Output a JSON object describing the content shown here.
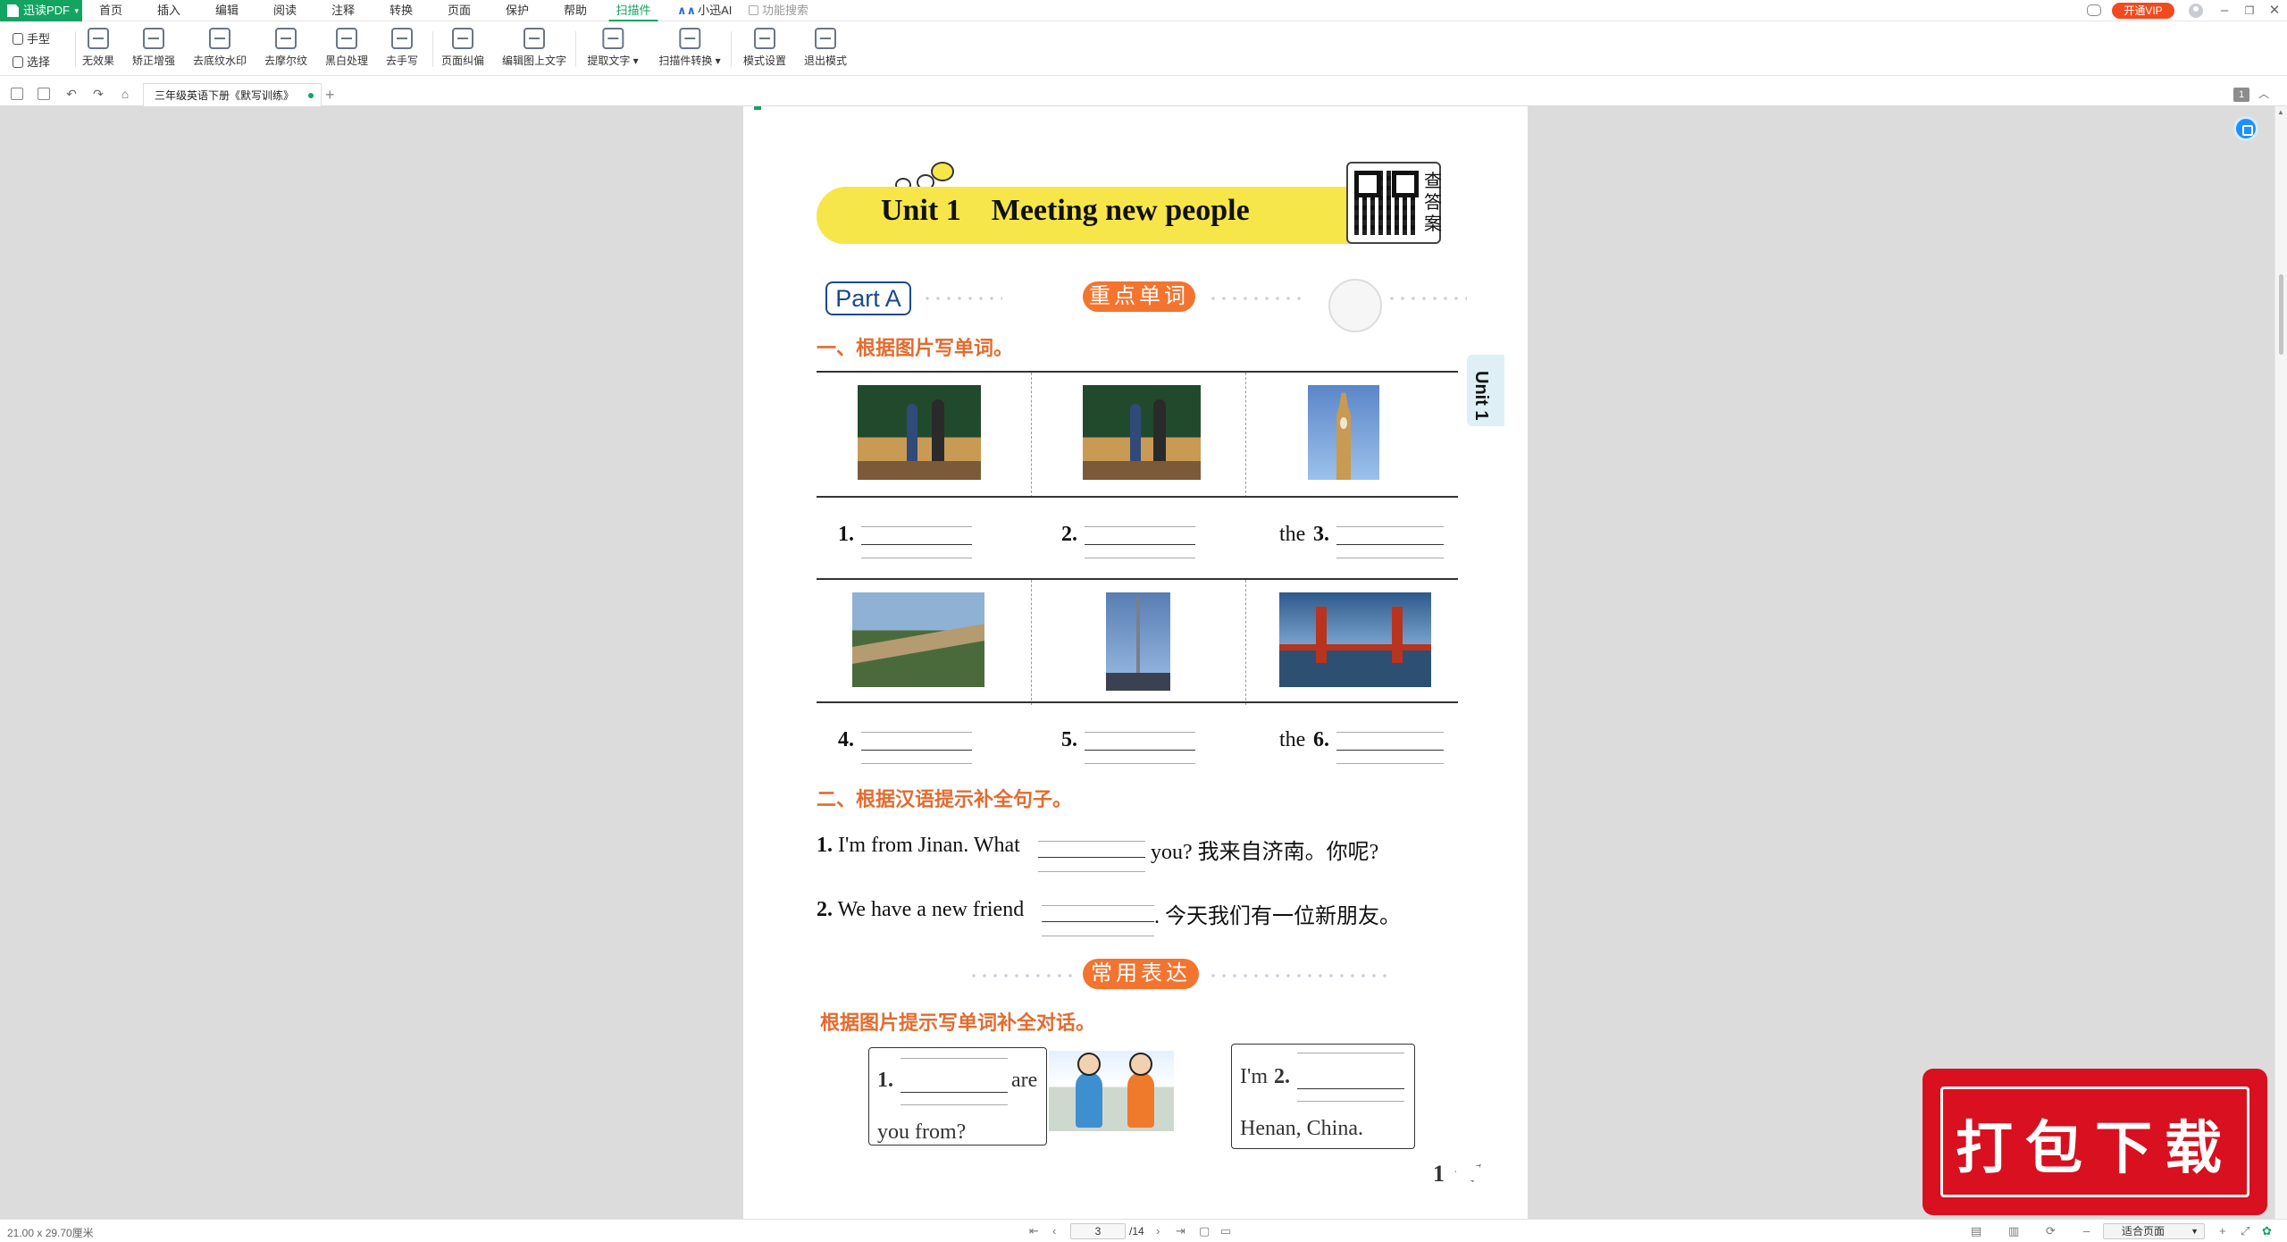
{
  "app": {
    "name": "迅读PDF"
  },
  "menu": {
    "items": [
      {
        "label": "首页"
      },
      {
        "label": "插入"
      },
      {
        "label": "编辑"
      },
      {
        "label": "阅读"
      },
      {
        "label": "注释"
      },
      {
        "label": "转换"
      },
      {
        "label": "页面"
      },
      {
        "label": "保护"
      },
      {
        "label": "帮助"
      },
      {
        "label": "扫描件",
        "active": true
      }
    ],
    "ai_label": "小迅AI",
    "function_search": "功能搜索",
    "vip_label": "开通VIP"
  },
  "ribbon": {
    "modes": [
      {
        "label": "手型",
        "icon": "hand-icon"
      },
      {
        "label": "选择",
        "icon": "select-icon"
      }
    ],
    "tools": [
      {
        "label": "无效果",
        "icon": "no-effect-icon"
      },
      {
        "label": "矫正增强",
        "icon": "enhance-icon"
      },
      {
        "label": "去底纹水印",
        "icon": "remove-watermark-icon"
      },
      {
        "label": "去摩尔纹",
        "icon": "remove-moire-icon"
      },
      {
        "label": "黑白处理",
        "icon": "black-white-icon"
      },
      {
        "label": "去手写",
        "icon": "remove-handwriting-icon"
      },
      {
        "label": "页面纠偏",
        "icon": "deskew-icon"
      },
      {
        "label": "编辑图上文字",
        "icon": "edit-image-text-icon"
      },
      {
        "label": "提取文字",
        "icon": "extract-text-icon",
        "dropdown": true
      },
      {
        "label": "扫描件转换",
        "icon": "scan-convert-icon",
        "dropdown": true
      },
      {
        "label": "模式设置",
        "icon": "mode-settings-icon"
      },
      {
        "label": "退出模式",
        "icon": "exit-mode-icon"
      }
    ]
  },
  "quickbar": {
    "tab_title": "三年级英语下册《默写训练》",
    "page_badge": "1"
  },
  "document": {
    "unit_title": "Unit 1    Meeting new people",
    "qr_label": "查答案",
    "part_label": "Part A",
    "vocab_pill": "重点单词",
    "section1_title": "一、根据图片写单词。",
    "row1": [
      {
        "prefix": "",
        "num": "1."
      },
      {
        "prefix": "",
        "num": "2."
      },
      {
        "prefix": "the",
        "num": "3."
      }
    ],
    "row2": [
      {
        "prefix": "",
        "num": "4."
      },
      {
        "prefix": "",
        "num": "5."
      },
      {
        "prefix": "the",
        "num": "6."
      }
    ],
    "section2_title": "二、根据汉语提示补全句子。",
    "sentences": [
      {
        "num": "1.",
        "before": "I'm from Jinan. What",
        "after": "you?  我来自济南。你呢?"
      },
      {
        "num": "2.",
        "before": "We have a new friend",
        "after": ". 今天我们有一位新朋友。"
      }
    ],
    "expression_pill": "常用表达",
    "section3_title": "根据图片提示写单词补全对话。",
    "dialog_left": {
      "num": "1.",
      "after": "are",
      "line2": "you from?"
    },
    "dialog_right": {
      "before": "I'm",
      "num": "2.",
      "line2": "Henan, China."
    },
    "side_tab": "Unit 1",
    "page_number": "1"
  },
  "watermark": {
    "label": "打包下载"
  },
  "statusbar": {
    "page_size": "21.00 x 29.70厘米",
    "current_page": "3",
    "total_pages": "/14",
    "zoom_mode": "适合页面"
  }
}
